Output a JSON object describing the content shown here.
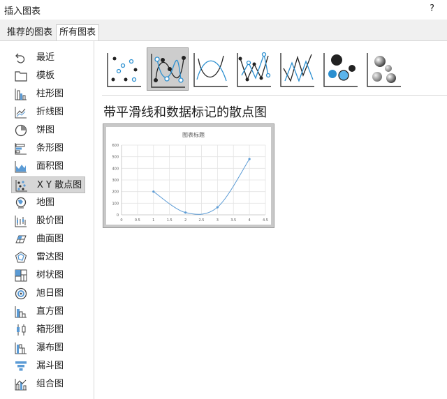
{
  "window": {
    "title": "插入图表",
    "help": "?"
  },
  "tabs": [
    {
      "label": "推荐的图表"
    },
    {
      "label": "所有图表"
    }
  ],
  "sidebar": {
    "items": [
      {
        "label": "最近",
        "icon": "recent-icon"
      },
      {
        "label": "模板",
        "icon": "folder-icon"
      },
      {
        "label": "柱形图",
        "icon": "column-chart-icon"
      },
      {
        "label": "折线图",
        "icon": "line-chart-icon"
      },
      {
        "label": "饼图",
        "icon": "pie-chart-icon"
      },
      {
        "label": "条形图",
        "icon": "bar-chart-icon"
      },
      {
        "label": "面积图",
        "icon": "area-chart-icon"
      },
      {
        "label": "X Y 散点图",
        "icon": "scatter-chart-icon",
        "selected": true
      },
      {
        "label": "地图",
        "icon": "map-chart-icon"
      },
      {
        "label": "股价图",
        "icon": "stock-chart-icon"
      },
      {
        "label": "曲面图",
        "icon": "surface-chart-icon"
      },
      {
        "label": "雷达图",
        "icon": "radar-chart-icon"
      },
      {
        "label": "树状图",
        "icon": "treemap-chart-icon"
      },
      {
        "label": "旭日图",
        "icon": "sunburst-chart-icon"
      },
      {
        "label": "直方图",
        "icon": "histogram-chart-icon"
      },
      {
        "label": "箱形图",
        "icon": "box-whisker-chart-icon"
      },
      {
        "label": "瀑布图",
        "icon": "waterfall-chart-icon"
      },
      {
        "label": "漏斗图",
        "icon": "funnel-chart-icon"
      },
      {
        "label": "组合图",
        "icon": "combo-chart-icon"
      }
    ]
  },
  "subtypes": {
    "selected_index": 1,
    "items": [
      {
        "icon": "scatter-icon"
      },
      {
        "icon": "scatter-smooth-markers-icon"
      },
      {
        "icon": "scatter-smooth-lines-icon"
      },
      {
        "icon": "scatter-straight-markers-icon"
      },
      {
        "icon": "scatter-straight-lines-icon"
      },
      {
        "icon": "bubble-icon"
      },
      {
        "icon": "bubble-3d-icon"
      }
    ]
  },
  "main": {
    "subtype_title": "带平滑线和数据标记的散点图"
  },
  "chart_data": {
    "type": "scatter",
    "title": "图表标题",
    "xlabel": "",
    "ylabel": "",
    "xlim": [
      0,
      4.5
    ],
    "ylim": [
      0,
      600
    ],
    "xticks": [
      "0",
      "0.5",
      "1",
      "1.5",
      "2",
      "2.5",
      "3",
      "3.5",
      "4",
      "4.5"
    ],
    "yticks": [
      "0",
      "100",
      "200",
      "300",
      "400",
      "500",
      "600"
    ],
    "grid": true,
    "smooth": true,
    "markers": true,
    "color": "#5b9bd5",
    "series": [
      {
        "x": [
          1,
          2,
          3,
          4
        ],
        "y": [
          200,
          20,
          65,
          480
        ]
      }
    ]
  },
  "colors": {
    "accent": "#5b9bd5",
    "selected_bg": "#d6d6d6",
    "chart_line": "#5b9bd5"
  }
}
